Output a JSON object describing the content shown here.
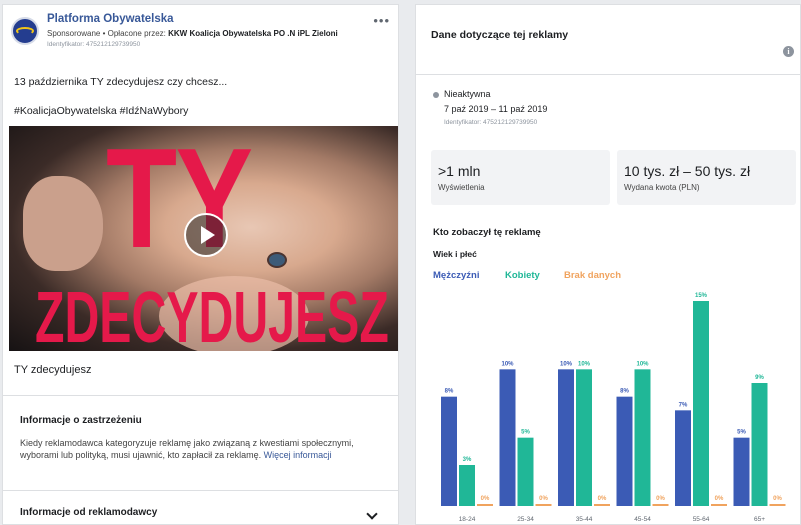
{
  "left": {
    "page_name": "Platforma Obywatelska",
    "sponsored_label": "Sponsorowane",
    "paid_prefix": " • Opłacone przez: ",
    "paid_by": "KKW Koalicja Obywatelska PO .N iPL Zieloni",
    "id_text": "Identyfikator: 475212129739950",
    "more_label": "•••",
    "post_text": "13 października TY zdecydujesz czy chcesz...",
    "hashtags": "#KoalicjaObywatelska #IdźNaWybory",
    "media_text_top": "TY",
    "media_text_bottom": "ZDECYDUJESZ",
    "video_title": "TY zdecydujesz",
    "disclaimer_title": "Informacje o zastrzeżeniu",
    "disclaimer_text": "Kiedy reklamodawca kategoryzuje reklamę jako związaną z kwestiami społecznymi, wyborami lub polityką, musi ujawnić, kto zapłacił za reklamę.",
    "more_info": "Więcej informacji",
    "advertiser_info": "Informacje od reklamodawcy"
  },
  "right": {
    "title": "Dane dotyczące tej reklamy",
    "info_icon": "i",
    "status": "Nieaktywna",
    "dates": "7 paź 2019 – 11 paź 2019",
    "id_text": "Identyfikator: 475212129739950",
    "impressions_value": ">1 mln",
    "impressions_label": "Wyświetlenia",
    "spend_value": "10 tys. zł – 50 tys. zł",
    "spend_label": "Wydana kwota (PLN)",
    "who_title": "Kto zobaczył tę reklamę",
    "age_sex": "Wiek i płeć",
    "legend": [
      {
        "label": "Mężczyźni",
        "color": "#3b5bb5"
      },
      {
        "label": "Kobiety",
        "color": "#20b797"
      },
      {
        "label": "Brak danych",
        "color": "#f0a35e"
      }
    ]
  },
  "chart_data": {
    "type": "bar",
    "categories": [
      "18-24",
      "25-34",
      "35-44",
      "45-54",
      "55-64",
      "65+"
    ],
    "series": [
      {
        "name": "Mężczyźni",
        "values": [
          8,
          10,
          10,
          8,
          7,
          5
        ],
        "labels": [
          "8%",
          "10%",
          "10%",
          "8%",
          "7%",
          "5%"
        ],
        "color": "#3b5bb5"
      },
      {
        "name": "Kobiety",
        "values": [
          3,
          5,
          10,
          10,
          15,
          9
        ],
        "labels": [
          "3%",
          "5%",
          "10%",
          "10%",
          "15%",
          "9%"
        ],
        "color": "#20b797"
      },
      {
        "name": "Brak danych",
        "values": [
          0,
          0,
          0,
          0,
          0,
          0
        ],
        "labels": [
          "0%",
          "0%",
          "0%",
          "0%",
          "0%",
          "0%"
        ],
        "color": "#f0a35e"
      }
    ],
    "ylim": [
      0,
      15
    ]
  }
}
